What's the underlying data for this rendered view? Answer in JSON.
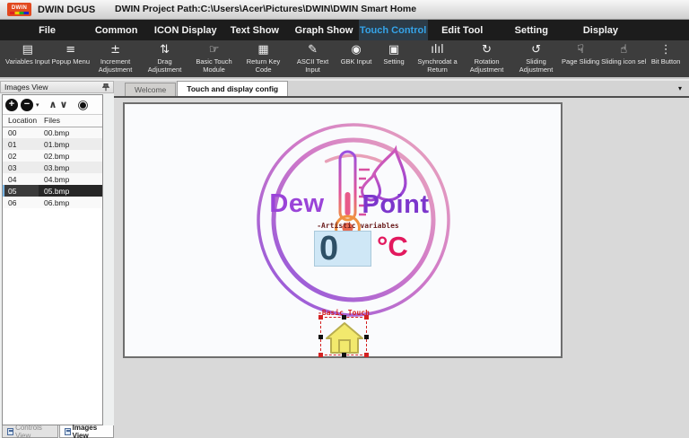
{
  "titlebar": {
    "logo_text": "DWIN",
    "app_name": "DWIN DGUS",
    "project_path": "DWIN Project Path:C:\\Users\\Acer\\Pictures\\DWIN\\DWIN Smart Home"
  },
  "menubar": {
    "items": [
      {
        "label": "File",
        "active": false
      },
      {
        "label": "Common",
        "active": false
      },
      {
        "label": "ICON Display",
        "active": false
      },
      {
        "label": "Text Show",
        "active": false
      },
      {
        "label": "Graph Show",
        "active": false
      },
      {
        "label": "Touch Control",
        "active": true
      },
      {
        "label": "Edit Tool",
        "active": false
      },
      {
        "label": "Setting",
        "active": false
      },
      {
        "label": "Display",
        "active": false
      }
    ]
  },
  "toolbar": {
    "buttons": [
      {
        "icon": "▤",
        "label": "Variables Input"
      },
      {
        "icon": "≡",
        "label": "Popup Menu"
      },
      {
        "icon": "±",
        "label": "Increment Adjustment"
      },
      {
        "icon": "⇅",
        "label": "Drag Adjustment"
      },
      {
        "icon": "☞",
        "label": "Basic Touch Module"
      },
      {
        "icon": "▦",
        "label": "Return Key Code"
      },
      {
        "icon": "✎",
        "label": "ASCII Text Input"
      },
      {
        "icon": "◉",
        "label": "GBK Input"
      },
      {
        "icon": "▣",
        "label": "Setting"
      },
      {
        "icon": "ılıl",
        "label": "Synchrodat a Return"
      },
      {
        "icon": "↻",
        "label": "Rotation Adjustment"
      },
      {
        "icon": "↺",
        "label": "Sliding Adjustment"
      },
      {
        "icon": "☟",
        "label": "Page Sliding"
      },
      {
        "icon": "☝",
        "label": "Sliding icon sel"
      },
      {
        "icon": "⋮",
        "label": "Bit Button"
      }
    ]
  },
  "images_panel": {
    "title": "Images View",
    "tools": {
      "add": "+",
      "remove": "−",
      "caret": "▾",
      "up": "∧",
      "down": "∨",
      "eye": "◉"
    },
    "columns": {
      "location": "Location",
      "files": "Files"
    },
    "rows": [
      {
        "location": "00",
        "file": "00.bmp",
        "selected": false
      },
      {
        "location": "01",
        "file": "01.bmp",
        "selected": false
      },
      {
        "location": "02",
        "file": "02.bmp",
        "selected": false
      },
      {
        "location": "03",
        "file": "03.bmp",
        "selected": false
      },
      {
        "location": "04",
        "file": "04.bmp",
        "selected": false
      },
      {
        "location": "05",
        "file": "05.bmp",
        "selected": true
      },
      {
        "location": "06",
        "file": "06.bmp",
        "selected": false
      }
    ]
  },
  "view_tabs": [
    {
      "label": "Controls View",
      "active": false
    },
    {
      "label": "Images View",
      "active": true
    }
  ],
  "document": {
    "tabs": [
      {
        "label": "Welcome",
        "active": false
      },
      {
        "label": "Touch and display config",
        "active": true
      }
    ],
    "overflow_caret": "▾"
  },
  "canvas": {
    "title_left": "Dew",
    "title_right": "Point",
    "variable_label": "-Artistic variables",
    "variable_value": "0",
    "variable_unit": "°C",
    "touch_label": "-Basic Touch"
  },
  "colors": {
    "accent_blue": "#35a3e8",
    "ring_pink": "#ecaabc",
    "ring_purple": "#8d55dd",
    "title_purple": "#7c36cc",
    "unit_crimson": "#e2195e",
    "value_navy": "#2e5066",
    "value_box_blue": "#cfe7f6",
    "house_yellow": "#f2e96d",
    "selection_red": "#d42222"
  }
}
